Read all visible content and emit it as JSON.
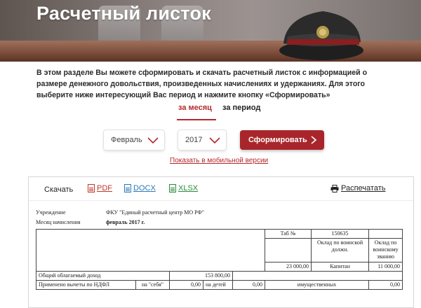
{
  "banner": {
    "title": "Расчетный листок"
  },
  "intro": {
    "text": "В этом разделе Вы можете сформировать и скачать расчетный листок с информацией о размере денежного довольствия, произведенных начислениях и удержаниях. Для этого выберите ниже интересующий Вас период и нажмите кнопку «Сформировать»"
  },
  "tabs": [
    {
      "label": "за месяц",
      "active": true
    },
    {
      "label": "за период",
      "active": false
    }
  ],
  "controls": {
    "month_value": "Февраль",
    "year_value": "2017",
    "generate_label": "Сформировать",
    "mobile_link": "Показать в мобильной версии"
  },
  "toolbar": {
    "download_label": "Скачать",
    "pdf": "PDF",
    "docx": "DOCX",
    "xlsx": "XLSX",
    "print": "Распечатать"
  },
  "slip": {
    "institution_label": "Учреждение",
    "institution_value": "ФКУ \"Единый расчетный центр МО РФ\"",
    "month_label": "Месяц начисления",
    "month_value": "февраль 2017 г.",
    "tab_label": "Таб №",
    "tab_value": "150635",
    "salary_position_label": "Оклад по воинской должн.",
    "salary_rank_label": "Оклад по воинскому званию",
    "salary_position_value": "23 000,00",
    "rank_value": "Капитан",
    "salary_rank_value": "11 000,00",
    "income_label": "Общий облагаемый доход",
    "income_value": "153 800,00",
    "deductions_label": "Применено вычеты по НДФЛ",
    "self_label": "на \"себя\"",
    "self_value": "0,00",
    "children_label": "на детей",
    "children_value": "0,00",
    "property_label": "имущественных",
    "property_value": "0,00"
  },
  "colors": {
    "accent": "#b4282d",
    "button": "#a8262b",
    "pdf": "#c0392b",
    "docx": "#2a7ab8",
    "xlsx": "#2a8a3e"
  }
}
